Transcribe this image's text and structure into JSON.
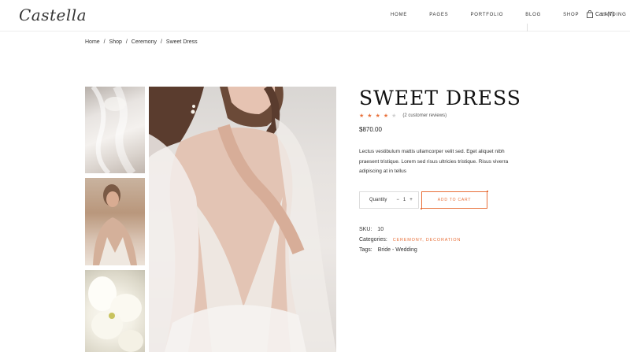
{
  "header": {
    "logo": "Castella",
    "nav": [
      "HOME",
      "PAGES",
      "PORTFOLIO",
      "BLOG",
      "SHOP",
      "LANDING"
    ],
    "cart_label": "Cart (7)"
  },
  "breadcrumb": [
    "Home",
    "/",
    "Shop",
    "/",
    "Ceremony",
    "/",
    "Sweet Dress"
  ],
  "product": {
    "title": "SWEET DRESS",
    "rating": 4,
    "rating_max": 5,
    "reviews": "(2 customer reviews)",
    "price": "$870.00",
    "description": "Lectus vestibulum mattis ullamcorper velit sed. Eget aliquet nibh praesent tristique. Lorem sed risus ultricies tristique. Risus viverra adipiscing at in tellus",
    "quantity_label": "Quantity",
    "quantity_value": "1",
    "minus": "−",
    "plus": "+",
    "add_to_cart": "ADD TO CART",
    "sku_label": "SKU:",
    "sku_value": "10",
    "categories_label": "Categories:",
    "categories_value": "CEREMONY, DECORATION",
    "tags_label": "Tags:",
    "tags_value": "Bride - Wedding"
  },
  "colors": {
    "accent": "#e8703a",
    "text": "#222222",
    "border": "#dddddd"
  }
}
